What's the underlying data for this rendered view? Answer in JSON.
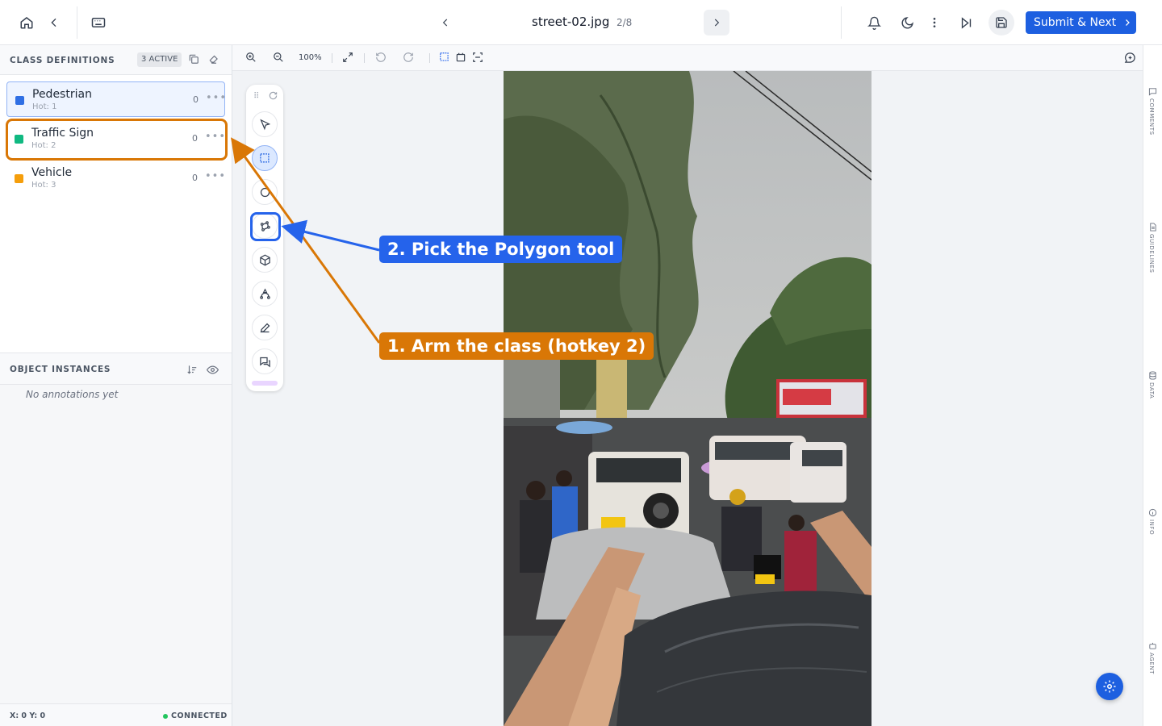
{
  "header": {
    "filename": "street-02.jpg",
    "page_count": "2/8",
    "submit_label": "Submit & Next"
  },
  "class_panel": {
    "title": "CLASS DEFINITIONS",
    "badge": "3 ACTIVE",
    "items": [
      {
        "name": "Pedestrian",
        "hotkey": "Hot: 1",
        "count": "0",
        "color": "#2f6fe4"
      },
      {
        "name": "Traffic Sign",
        "hotkey": "Hot: 2",
        "count": "0",
        "color": "#10b981"
      },
      {
        "name": "Vehicle",
        "hotkey": "Hot: 3",
        "count": "0",
        "color": "#f59e0b"
      }
    ]
  },
  "instances_panel": {
    "title": "OBJECT INSTANCES",
    "empty_text": "No annotations yet"
  },
  "footer": {
    "coords": "X: 0 Y: 0",
    "status": "CONNECTED"
  },
  "canvas_toolbar": {
    "zoom": "100%"
  },
  "tools": [
    "select",
    "box",
    "circle",
    "polygon",
    "cuboid",
    "curve",
    "pencil",
    "comment"
  ],
  "right_rail": [
    "COMMENTS",
    "GUIDELINES",
    "DATA",
    "INFO",
    "AGENT"
  ],
  "annotations": {
    "step1": "1. Arm the class (hotkey 2)",
    "step2": "2. Pick the Polygon tool",
    "step1_color": "#d97706",
    "step2_color": "#2563eb"
  }
}
